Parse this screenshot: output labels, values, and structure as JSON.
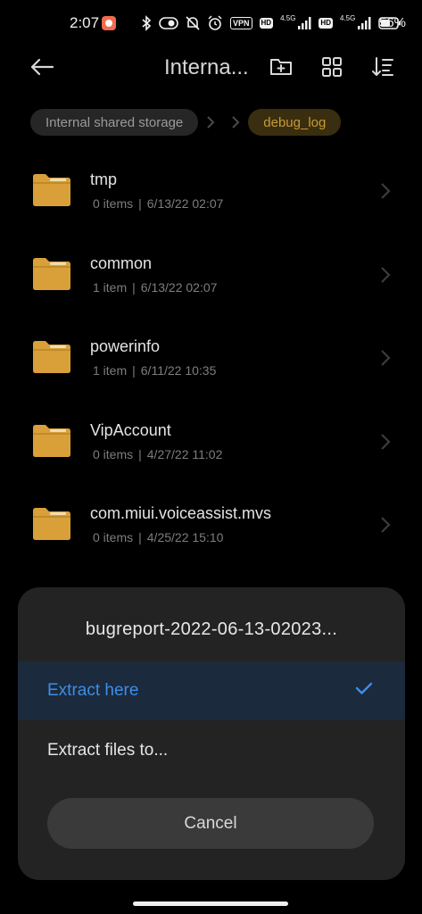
{
  "status_bar": {
    "time": "2:07",
    "network_1": "4.5G",
    "network_2": "4.5G",
    "vpn": "VPN",
    "hd_1": "HD",
    "hd_2": "HD",
    "battery_percent": "56%"
  },
  "top_bar": {
    "title": "Interna..."
  },
  "breadcrumb": {
    "root": "Internal shared storage",
    "current": "debug_log"
  },
  "files": [
    {
      "name": "tmp",
      "count": "0 items",
      "date": "6/13/22 02:07"
    },
    {
      "name": "common",
      "count": "1 item",
      "date": "6/13/22 02:07"
    },
    {
      "name": "powerinfo",
      "count": "1 item",
      "date": "6/11/22 10:35"
    },
    {
      "name": "VipAccount",
      "count": "0 items",
      "date": "4/27/22 11:02"
    },
    {
      "name": "com.miui.voiceassist.mvs",
      "count": "0 items",
      "date": "4/25/22 15:10"
    }
  ],
  "dialog": {
    "title": "bugreport-2022-06-13-02023...",
    "options": [
      {
        "label": "Extract here",
        "selected": true
      },
      {
        "label": "Extract files to...",
        "selected": false
      }
    ],
    "cancel": "Cancel"
  },
  "colors": {
    "accent_blue": "#3d8ee8",
    "folder_gold": "#d9a03a",
    "crumb_active": "#c99a33",
    "background": "#000000",
    "sheet": "#232323"
  }
}
